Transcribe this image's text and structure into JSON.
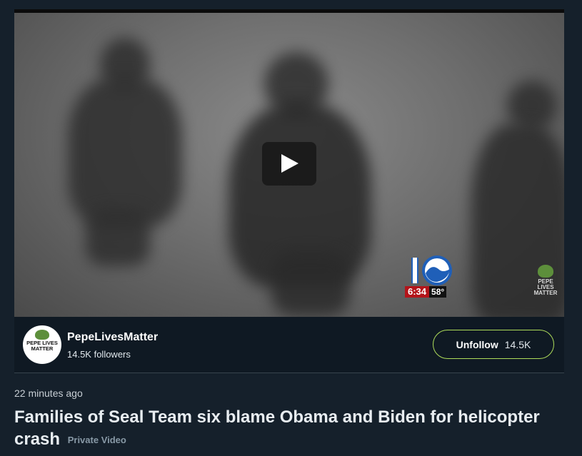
{
  "video": {
    "station_time": "6:34",
    "station_temp": "58°",
    "watermark_text": "PEPE LIVES MATTER",
    "play_icon": "play-icon"
  },
  "creator": {
    "name": "PepeLivesMatter",
    "followers": "14.5K followers",
    "avatar_text": "PEPE LIVES MATTER"
  },
  "follow": {
    "label": "Unfollow",
    "count": "14.5K",
    "border_color": "#aedc5a"
  },
  "post": {
    "timestamp": "22 minutes ago",
    "title": "Families of Seal Team six blame Obama and Biden for helicopter crash",
    "privacy": "Private Video"
  },
  "colors": {
    "background": "#15202b",
    "panel": "#0f1923",
    "station_red": "#b3141a"
  }
}
